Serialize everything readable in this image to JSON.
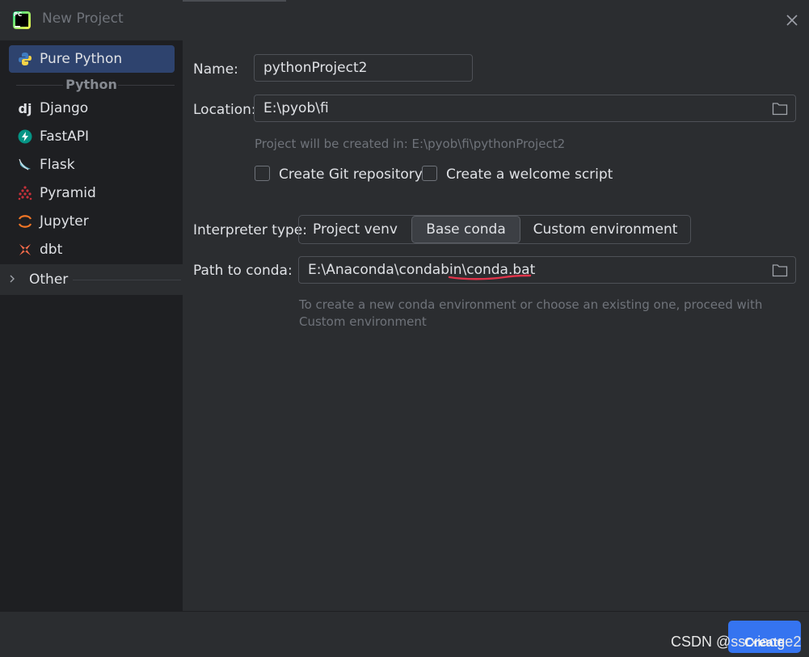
{
  "window": {
    "title": "New Project"
  },
  "sidebar": {
    "items": [
      {
        "label": "Pure Python",
        "icon": "python-icon"
      },
      {
        "label": "Django",
        "icon": "django-icon"
      },
      {
        "label": "FastAPI",
        "icon": "fastapi-icon"
      },
      {
        "label": "Flask",
        "icon": "flask-icon"
      },
      {
        "label": "Pyramid",
        "icon": "pyramid-icon"
      },
      {
        "label": "Jupyter",
        "icon": "jupyter-icon"
      },
      {
        "label": "dbt",
        "icon": "dbt-icon"
      }
    ],
    "group_label": "Python",
    "other_label": "Other",
    "django_glyph": "dj"
  },
  "form": {
    "name_label": "Name:",
    "name_value": "pythonProject2",
    "location_label": "Location:",
    "location_value": "E:\\pyob\\fi",
    "location_hint": "Project will be created in: E:\\pyob\\fi\\pythonProject2",
    "git_label": "Create Git repository",
    "welcome_label": "Create a welcome script",
    "interpreter_label": "Interpreter type:",
    "interpreter_options": [
      "Project venv",
      "Base conda",
      "Custom environment"
    ],
    "interpreter_selected": "Base conda",
    "conda_label": "Path to conda:",
    "conda_value": "E:\\Anaconda\\condabin\\conda.bat",
    "conda_hint_line1": "To create a new conda environment or choose an existing one, proceed with",
    "conda_hint_line2": "Custom environment"
  },
  "footer": {
    "create_label": "Create",
    "watermark": "CSDN @ssrxiaoge2"
  },
  "colors": {
    "accent": "#3574f0",
    "selection": "#2e436e",
    "annotation": "#e0344a"
  }
}
